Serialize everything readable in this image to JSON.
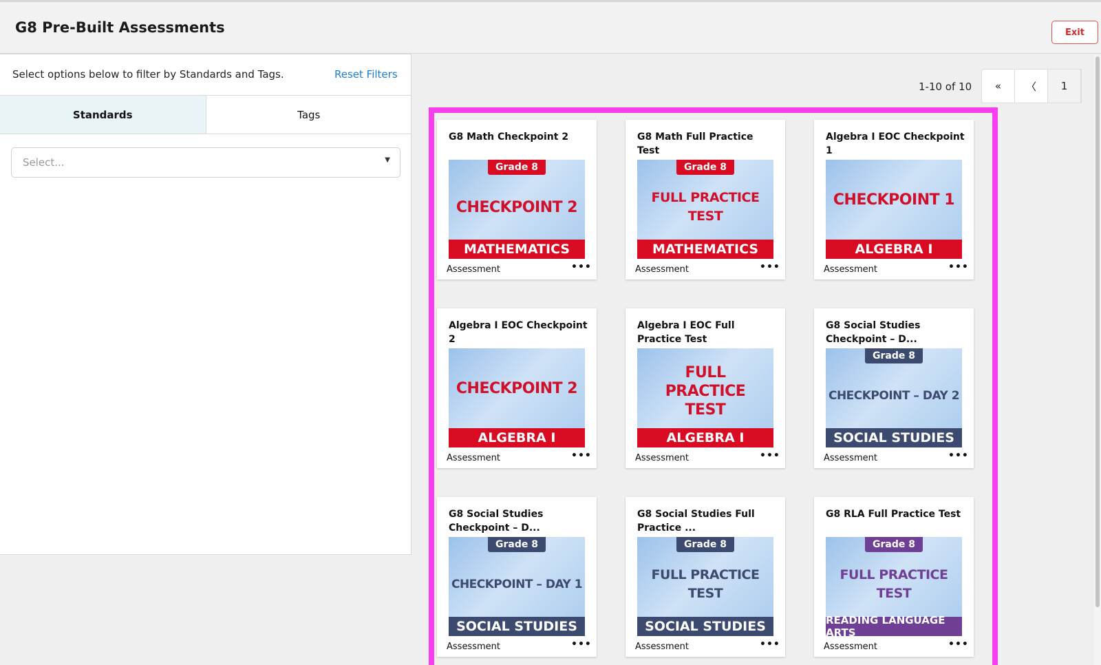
{
  "header": {
    "title": "G8 Pre-Built Assessments",
    "exit_label": "Exit"
  },
  "sidebar": {
    "intro": "Select options below to filter by Standards and Tags.",
    "reset_label": "Reset Filters",
    "tabs": [
      {
        "label": "Standards"
      },
      {
        "label": "Tags"
      }
    ],
    "select_placeholder": "Select..."
  },
  "pagination": {
    "range": "1-10 of 10",
    "first": "«",
    "prev": "〈",
    "current_page": "1"
  },
  "cards": [
    {
      "title": "G8 Math Checkpoint 2",
      "badge": "Grade 8",
      "main": "CHECKPOINT 2",
      "sub": "MATHEMATICS",
      "type": "Assessment",
      "more": "•••"
    },
    {
      "title": "G8 Math Full Practice Test",
      "badge": "Grade 8",
      "main": "FULL PRACTICE TEST",
      "sub": "MATHEMATICS",
      "type": "Assessment",
      "more": "•••"
    },
    {
      "title": "Algebra I EOC Checkpoint 1",
      "badge": "",
      "main": "CHECKPOINT 1",
      "sub": "ALGEBRA I",
      "type": "Assessment",
      "more": "•••"
    },
    {
      "title": "Algebra I EOC Checkpoint 2",
      "badge": "",
      "main": "CHECKPOINT 2",
      "sub": "ALGEBRA I",
      "type": "Assessment",
      "more": "•••"
    },
    {
      "title": "Algebra I EOC Full Practice Test",
      "badge": "",
      "main": "FULL PRACTICE TEST",
      "sub": "ALGEBRA I",
      "type": "Assessment",
      "more": "•••"
    },
    {
      "title": "G8 Social Studies Checkpoint – D...",
      "badge": "Grade 8",
      "main": "CHECKPOINT – DAY 2",
      "sub": "SOCIAL STUDIES",
      "type": "Assessment",
      "more": "•••"
    },
    {
      "title": "G8 Social Studies Checkpoint – D...",
      "badge": "Grade 8",
      "main": "CHECKPOINT – DAY 1",
      "sub": "SOCIAL STUDIES",
      "type": "Assessment",
      "more": "•••"
    },
    {
      "title": "G8 Social Studies Full Practice ...",
      "badge": "Grade 8",
      "main": "FULL PRACTICE TEST",
      "sub": "SOCIAL STUDIES",
      "type": "Assessment",
      "more": "•••"
    },
    {
      "title": "G8 RLA Full Practice Test",
      "badge": "Grade 8",
      "main": "FULL PRACTICE TEST",
      "sub": "READING LANGUAGE ARTS",
      "type": "Assessment",
      "more": "•••"
    }
  ],
  "colors": {
    "accent_red": "#d80b22",
    "navy": "#3d4a70",
    "purple": "#6e3f95",
    "highlight_frame": "#f73ff0",
    "link_blue": "#1a7fd4"
  }
}
